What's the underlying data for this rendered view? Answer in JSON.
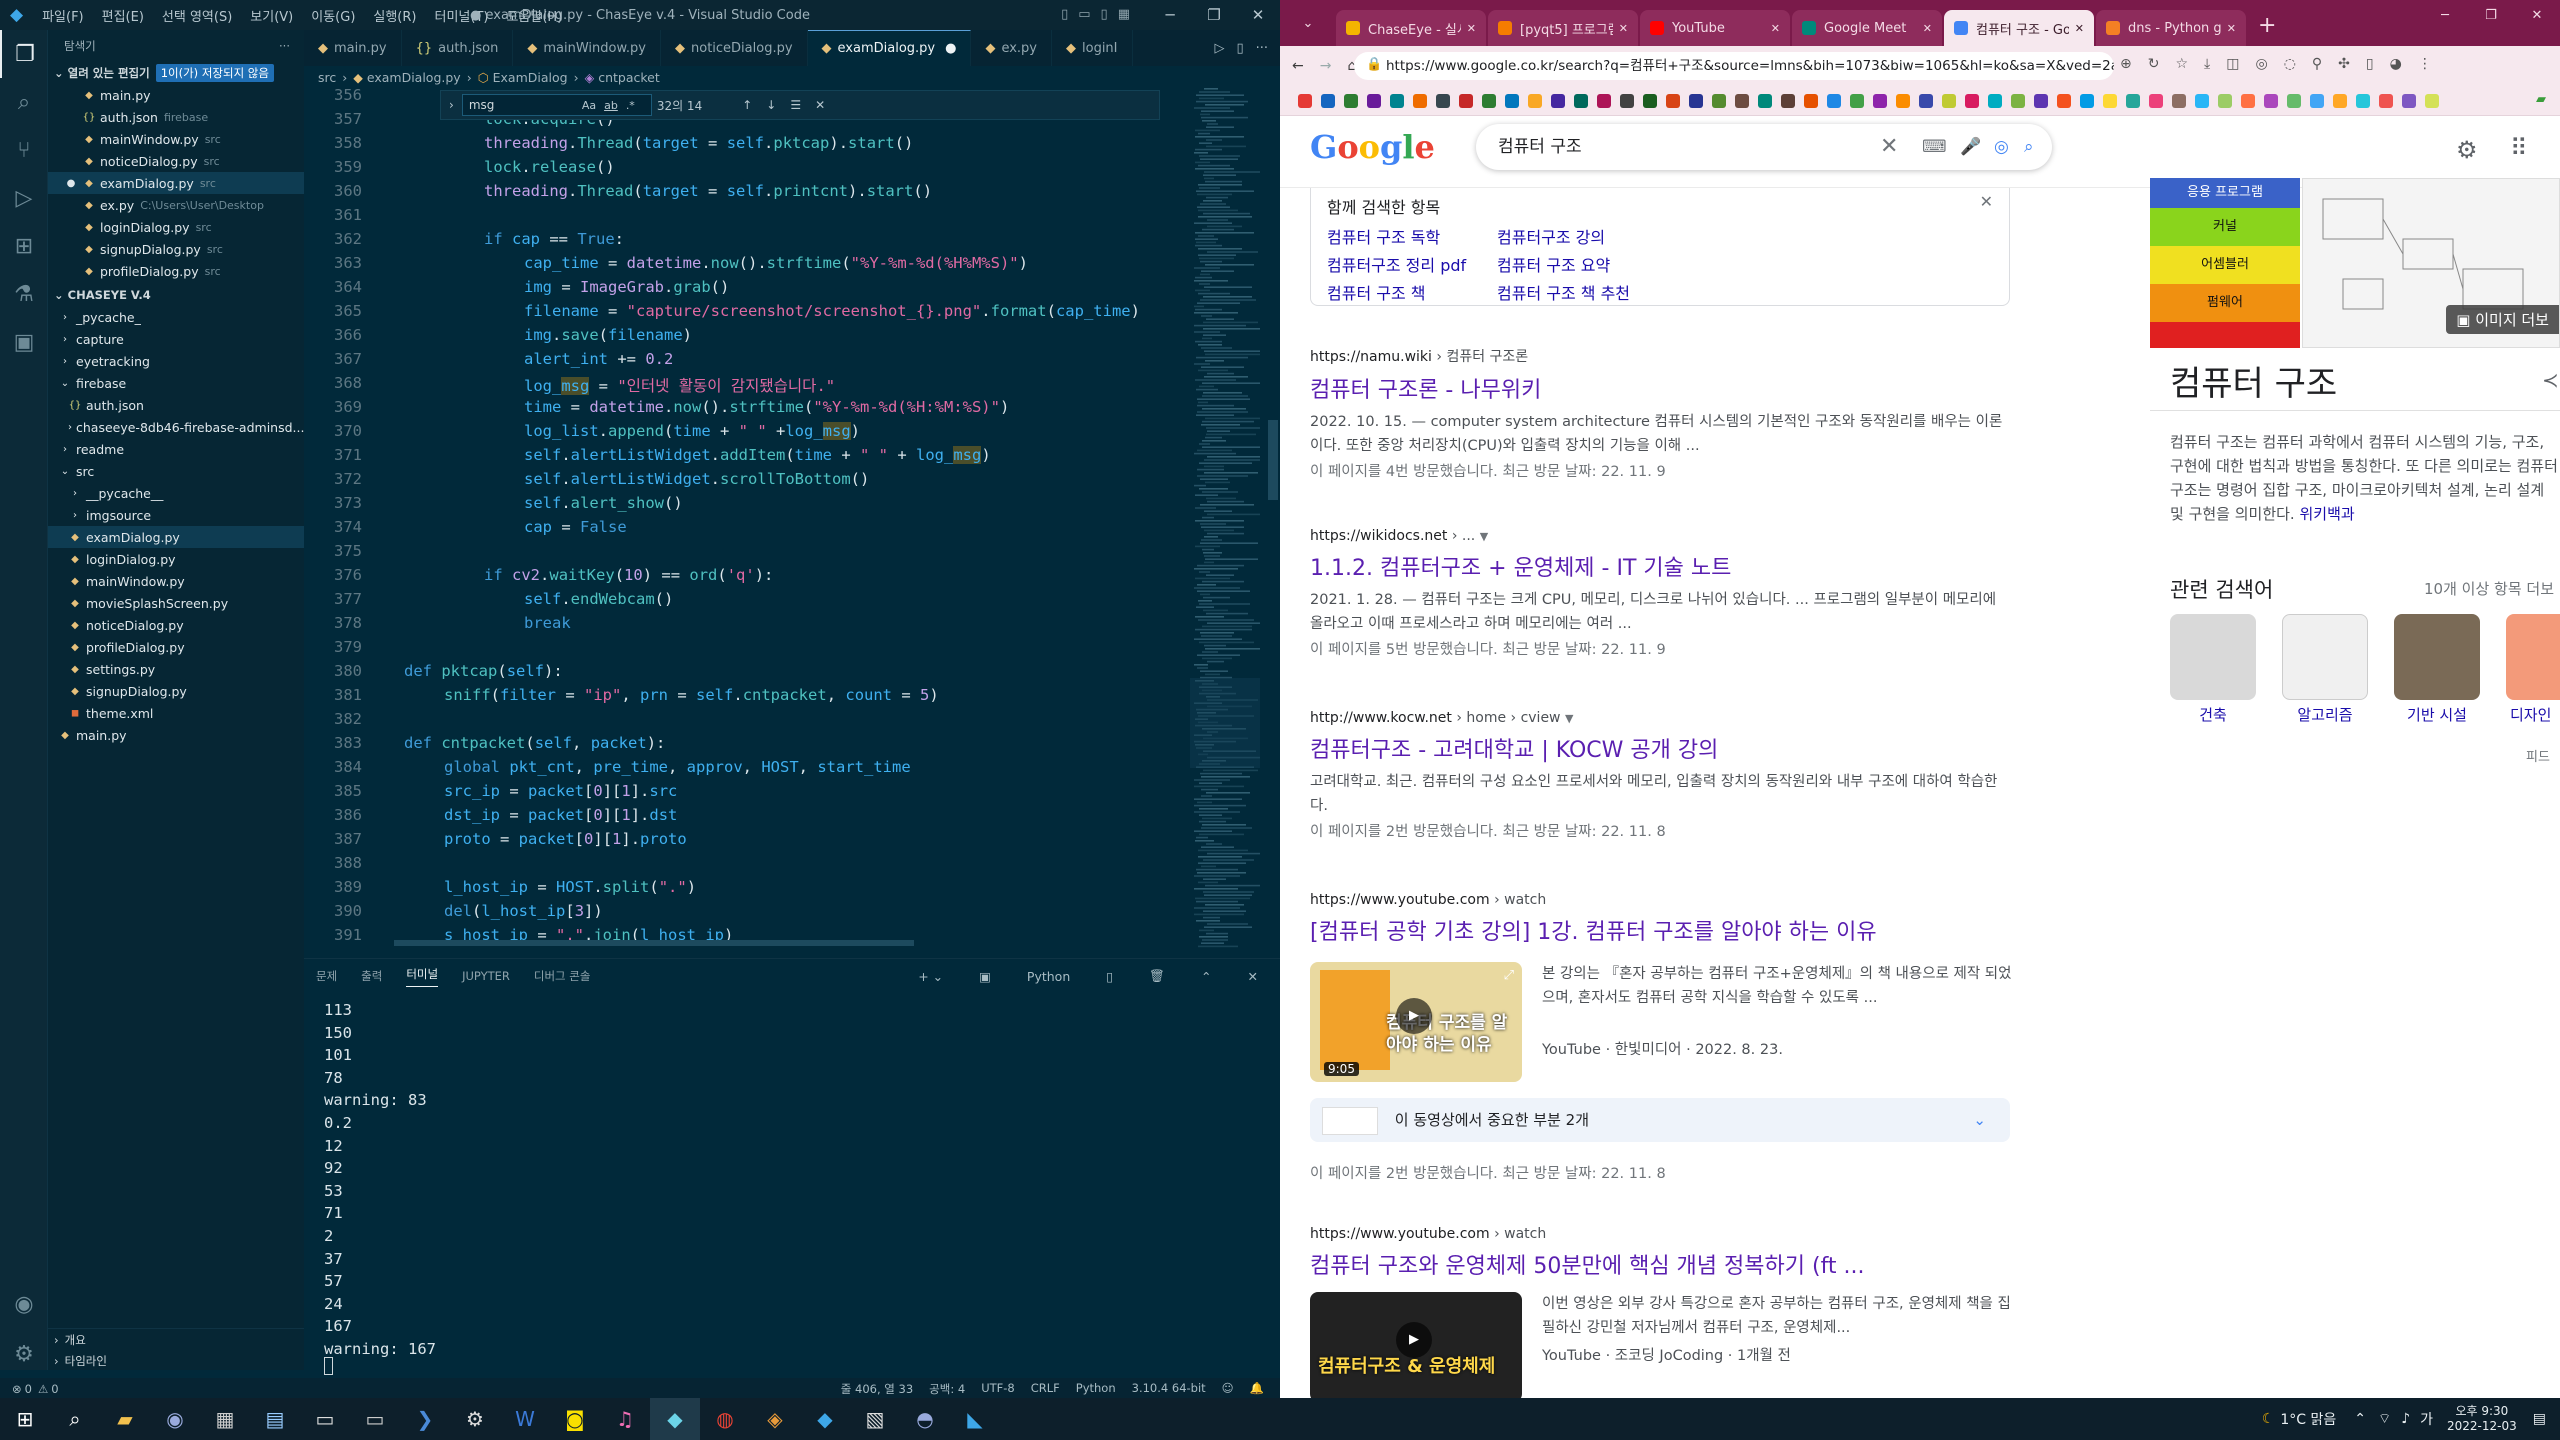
{
  "vscode": {
    "title": "● examDialog.py - ChasEye v.4 - Visual Studio Code",
    "menu": [
      "파일(F)",
      "편집(E)",
      "선택 영역(S)",
      "보기(V)",
      "이동(G)",
      "실행(R)",
      "터미널(T)",
      "도움말(H)"
    ],
    "explorer_title": "탐색기",
    "open_editors_label": "열려 있는 편집기",
    "unsaved_badge": "1이(가) 저장되지 않음",
    "open_editors": [
      {
        "name": "main.py",
        "dec": ""
      },
      {
        "name": "auth.json",
        "dec": "firebase"
      },
      {
        "name": "mainWindow.py",
        "dec": "src"
      },
      {
        "name": "noticeDialog.py",
        "dec": "src"
      },
      {
        "name": "examDialog.py",
        "dec": "src"
      },
      {
        "name": "ex.py",
        "dec": "C:\\Users\\User\\Desktop"
      },
      {
        "name": "loginDialog.py",
        "dec": "src"
      },
      {
        "name": "signupDialog.py",
        "dec": "src"
      },
      {
        "name": "profileDialog.py",
        "dec": "src"
      }
    ],
    "project_label": "CHASEYE V.4",
    "tree": [
      {
        "name": "_pycache_",
        "indent": 1,
        "type": "folder"
      },
      {
        "name": "capture",
        "indent": 1,
        "type": "folder"
      },
      {
        "name": "eyetracking",
        "indent": 1,
        "type": "folder"
      },
      {
        "name": "firebase",
        "indent": 1,
        "type": "folder-open"
      },
      {
        "name": "auth.json",
        "indent": 2,
        "type": "json"
      },
      {
        "name": "chaseeye-8db46-firebase-adminsd...",
        "indent": 2,
        "type": "folder"
      },
      {
        "name": "readme",
        "indent": 1,
        "type": "folder"
      },
      {
        "name": "src",
        "indent": 1,
        "type": "folder-open"
      },
      {
        "name": "__pycache__",
        "indent": 2,
        "type": "folder"
      },
      {
        "name": "imgsource",
        "indent": 2,
        "type": "folder"
      },
      {
        "name": "examDialog.py",
        "indent": 2,
        "type": "py",
        "selected": true
      },
      {
        "name": "loginDialog.py",
        "indent": 2,
        "type": "py"
      },
      {
        "name": "mainWindow.py",
        "indent": 2,
        "type": "py"
      },
      {
        "name": "movieSplashScreen.py",
        "indent": 2,
        "type": "py"
      },
      {
        "name": "noticeDialog.py",
        "indent": 2,
        "type": "py"
      },
      {
        "name": "profileDialog.py",
        "indent": 2,
        "type": "py"
      },
      {
        "name": "settings.py",
        "indent": 2,
        "type": "py"
      },
      {
        "name": "signupDialog.py",
        "indent": 2,
        "type": "py"
      },
      {
        "name": "theme.xml",
        "indent": 2,
        "type": "xml"
      },
      {
        "name": "main.py",
        "indent": 1,
        "type": "py"
      }
    ],
    "outline_label": "개요",
    "timeline_label": "타임라인",
    "tabs": [
      "main.py",
      "auth.json",
      "mainWindow.py",
      "noticeDialog.py",
      "examDialog.py",
      "ex.py",
      "loginI"
    ],
    "breadcrumb": [
      "src",
      "examDialog.py",
      "ExamDialog",
      "cntpacket"
    ],
    "find": {
      "query": "msg",
      "result": "32의 14",
      "options": [
        "Aa",
        "ab",
        ".*"
      ]
    },
    "line_numbers": [
      "356",
      "357",
      "358",
      "359",
      "360",
      "361",
      "362",
      "363",
      "364",
      "365",
      "366",
      "367",
      "368",
      "369",
      "370",
      "371",
      "372",
      "373",
      "374",
      "375",
      "376",
      "377",
      "378",
      "379",
      "380",
      "381",
      "382",
      "383",
      "384",
      "385",
      "386",
      "387",
      "388",
      "389",
      "390",
      "391"
    ],
    "panel_tabs": [
      "문제",
      "출력",
      "터미널",
      "JUPYTER",
      "디버그 콘솔"
    ],
    "terminal_kind": "Python",
    "terminal_lines": [
      "113",
      "150",
      "101",
      "78",
      "warning: 83",
      "0.2",
      "12",
      "92",
      "53",
      "71",
      "2",
      "37",
      "57",
      "24",
      "167",
      "warning: 167"
    ],
    "status": {
      "errors": "0",
      "warnings": "0",
      "position": "줄 406, 열 33",
      "spaces": "공백: 4",
      "encoding": "UTF-8",
      "eol": "CRLF",
      "language": "Python",
      "interpreter": "3.10.4 64-bit"
    }
  },
  "chrome": {
    "tabs": [
      {
        "title": "ChaseEye - 실시간 트",
        "color": "#f4b400"
      },
      {
        "title": "[pyqt5] 프로그램창을",
        "color": "#f57c00"
      },
      {
        "title": "YouTube",
        "color": "#ff0000"
      },
      {
        "title": "Google Meet",
        "color": "#00897b"
      },
      {
        "title": "컴퓨터 구조 - Goog",
        "color": "#4285f4",
        "active": true
      },
      {
        "title": "dns - Python get do",
        "color": "#f48024"
      }
    ],
    "url": "https://www.google.co.kr/search?q=컴퓨터+구조&source=lmns&bih=1073&biw=1065&hl=ko&sa=X&ved=2ahUKEwjg7ufsud",
    "search_query": "컴퓨터 구조",
    "google_logo": "Google",
    "related_header": "함께 검색한 항목",
    "related_links": [
      "컴퓨터 구조 독학",
      "컴퓨터구조 강의",
      "컴퓨터구조 정리 pdf",
      "컴퓨터 구조 요약",
      "컴퓨터 구조 책",
      "컴퓨터 구조 책 추천"
    ],
    "results": [
      {
        "source": "https://namu.wiki",
        "path": "› 컴퓨터 구조론",
        "title": "컴퓨터 구조론 - 나무위키",
        "snippet": "2022. 10. 15. — computer system architecture 컴퓨터 시스템의 기본적인 구조와 동작원리를 배우는 이론이다. 또한 중앙 처리장치(CPU)와 입출력 장치의 기능을 이해 ...",
        "visit": "이 페이지를 4번 방문했습니다. 최근 방문 날짜: 22. 11. 9"
      },
      {
        "source": "https://wikidocs.net",
        "path": "› ...",
        "title": "1.1.2. 컴퓨터구조 + 운영체제 - IT 기술 노트",
        "snippet": "2021. 1. 28. — 컴퓨터 구조는 크게 CPU, 메모리, 디스크로 나뉘어 있습니다. ... 프로그램의 일부분이 메모리에 올라오고 이때 프로세스라고 하며 메모리에는 여러 ...",
        "visit": "이 페이지를 5번 방문했습니다. 최근 방문 날짜: 22. 11. 9"
      },
      {
        "source": "http://www.kocw.net",
        "path": "› home › cview",
        "title": "컴퓨터구조 - 고려대학교 | KOCW 공개 강의",
        "snippet": "고려대학교. 최근. 컴퓨터의 구성 요소인 프로세서와 메모리, 입출력 장치의 동작원리와 내부 구조에 대하여 학습한다.",
        "visit": "이 페이지를 2번 방문했습니다. 최근 방문 날짜: 22. 11. 8"
      }
    ],
    "video1": {
      "source": "https://www.youtube.com",
      "path": "› watch",
      "title": "[컴퓨터 공학 기초 강의] 1강. 컴퓨터 구조를 알아야 하는 이유",
      "snippet": "본 강의는 『혼자 공부하는 컴퓨터 구조+운영체제』의 책 내용으로 제작 되었으며, 혼자서도 컴퓨터 공학 지식을 학습할 수 있도록 ...",
      "channel": "YouTube · 한빛미디어 · 2022. 8. 23.",
      "duration": "9:05",
      "thumb_text": "컴퓨터 구조를 알아야 하는 이유",
      "key_moments": "이 동영상에서 중요한 부분 2개",
      "visit": "이 페이지를 2번 방문했습니다. 최근 방문 날짜: 22. 11. 8"
    },
    "video2": {
      "source": "https://www.youtube.com",
      "path": "› watch",
      "title": "컴퓨터 구조와 운영체제 50분만에 핵심 개념 정복하기 (ft ...",
      "snippet": "이번 영상은 외부 강사 특강으로 혼자 공부하는 컴퓨터 구조, 운영체제 책을 집필하신 강민철 저자님께서 컴퓨터 구조, 운영체제...",
      "channel": "YouTube · 조코딩 JoCoding · 1개월 전",
      "thumb_text": "컴퓨터구조 & 운영체제"
    },
    "knowledge": {
      "title": "컴퓨터 구조",
      "more_images": "이미지 더보",
      "layers": [
        "응용 프로그램",
        "커널",
        "어셈블러",
        "펌웨어"
      ],
      "desc": "컴퓨터 구조는 컴퓨터 과학에서 컴퓨터 시스템의 기능, 구조, 구현에 대한 법칙과 방법을 통칭한다. 또 다른 의미로는 컴퓨터 구조는 명령어 집합 구조, 마이크로아키텍처 설계, 논리 설계 및 구현을 의미한다.",
      "wiki": "위키백과",
      "related_title": "관련 검색어",
      "related_more": "10개 이상 항목 더보",
      "related": [
        "건축",
        "알고리즘",
        "기반 시설",
        "디자인"
      ],
      "feedback": "피드"
    }
  },
  "taskbar": {
    "weather": "1°C 맑음",
    "time": "오후 9:30",
    "date": "2022-12-03"
  }
}
